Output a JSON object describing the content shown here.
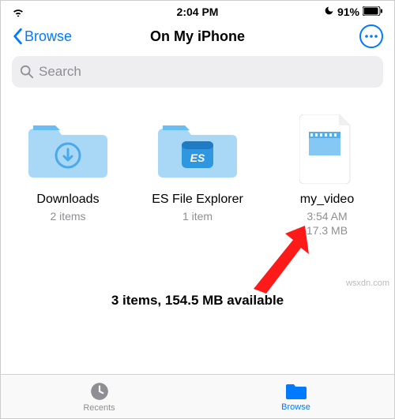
{
  "status": {
    "time": "2:04 PM",
    "battery": "91%"
  },
  "nav": {
    "back": "Browse",
    "title": "On My iPhone"
  },
  "search": {
    "placeholder": "Search"
  },
  "items": [
    {
      "name": "Downloads",
      "sub1": "2 items",
      "sub2": ""
    },
    {
      "name": "ES File Explorer",
      "sub1": "1 item",
      "sub2": ""
    },
    {
      "name": "my_video",
      "sub1": "3:54 AM",
      "sub2": "17.3 MB"
    }
  ],
  "summary": "3 items, 154.5 MB available",
  "tabs": {
    "recents": "Recents",
    "browse": "Browse"
  },
  "watermark": "wsxdn.com"
}
